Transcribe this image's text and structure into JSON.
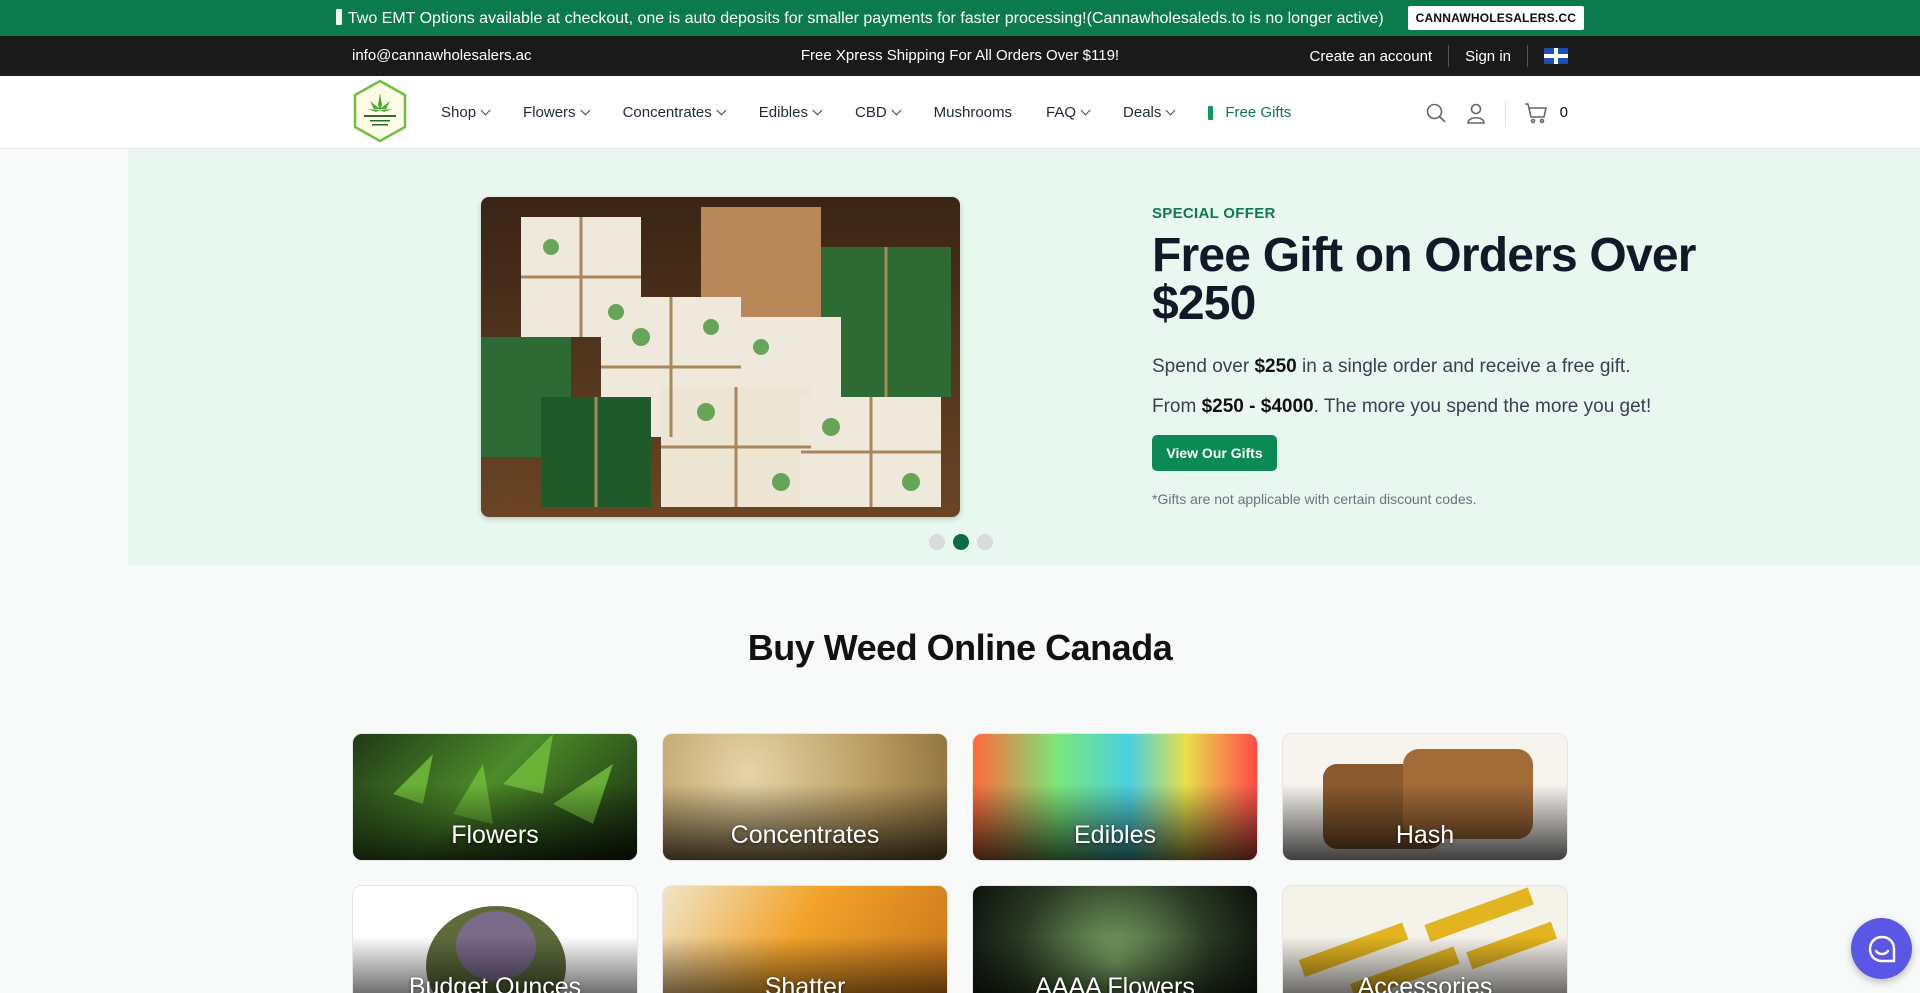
{
  "announcement": {
    "text": "Two EMT Options available at checkout, one is auto deposits for smaller payments for faster processing!(Cannawholesaleds.to is no longer active)",
    "code": "CANNAWHOLESALERS.CC"
  },
  "utility": {
    "email": "info@cannawholesalers.ac",
    "promo": "Free Xpress Shipping For All Orders Over $119!",
    "create_account": "Create an account",
    "sign_in": "Sign in"
  },
  "nav": {
    "items": [
      {
        "label": "Shop",
        "dropdown": true
      },
      {
        "label": "Flowers",
        "dropdown": true
      },
      {
        "label": "Concentrates",
        "dropdown": true
      },
      {
        "label": "Edibles",
        "dropdown": true
      },
      {
        "label": "CBD",
        "dropdown": true
      },
      {
        "label": "Mushrooms",
        "dropdown": false
      },
      {
        "label": "FAQ",
        "dropdown": true
      },
      {
        "label": "Deals",
        "dropdown": true
      },
      {
        "label": "Free Gifts",
        "dropdown": false
      }
    ],
    "cart_count": "0"
  },
  "hero": {
    "eyebrow": "SPECIAL OFFER",
    "title": "Free Gift on Orders Over $250",
    "line1_pre": "Spend over ",
    "line1_bold": "$250",
    "line1_post": " in a single order and receive a free gift.",
    "line2_pre": "From ",
    "line2_bold": "$250 - $4000",
    "line2_post": ". The more you spend the more you get!",
    "button": "View Our Gifts",
    "note": "*Gifts are not applicable with certain discount codes.",
    "active_slide": 2,
    "slide_count": 3
  },
  "section": {
    "title": "Buy Weed Online Canada",
    "categories": [
      "Flowers",
      "Concentrates",
      "Edibles",
      "Hash",
      "Budget Ounces",
      "Shatter",
      "AAAA Flowers",
      "Accessories"
    ]
  },
  "colors": {
    "brand_green": "#0b7a4c",
    "hero_bg": "#e8f8f0",
    "chat": "#5b57e6"
  }
}
